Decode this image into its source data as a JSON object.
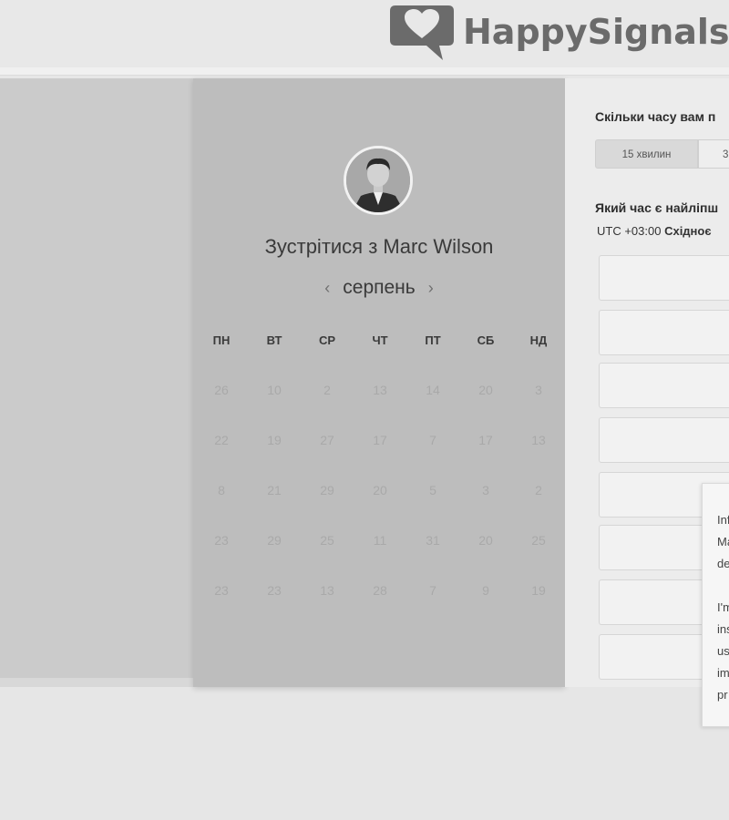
{
  "brand": {
    "name": "HappySignals"
  },
  "calendar": {
    "meet_title": "Зустрітися з Marc Wilson",
    "month": "серпень",
    "prev_icon": "‹",
    "next_icon": "›",
    "weekdays": [
      "ПН",
      "ВТ",
      "СР",
      "ЧТ",
      "ПТ",
      "СБ",
      "НД"
    ],
    "weeks": [
      [
        "26",
        "10",
        "2",
        "13",
        "14",
        "20",
        "3"
      ],
      [
        "22",
        "19",
        "27",
        "17",
        "7",
        "17",
        "13"
      ],
      [
        "8",
        "21",
        "29",
        "20",
        "5",
        "3",
        "2"
      ],
      [
        "23",
        "29",
        "25",
        "11",
        "31",
        "20",
        "25"
      ],
      [
        "23",
        "23",
        "13",
        "28",
        "7",
        "9",
        "19"
      ]
    ]
  },
  "booking": {
    "duration_question": "Скільки часу вам п",
    "durations": [
      "15 хвилин",
      "3"
    ],
    "time_question": "Який час є найліпш",
    "timezone_offset": "UTC +03:00",
    "timezone_name": "Східноє"
  },
  "popup": {
    "lines": [
      "Inf",
      "Ma",
      "de",
      "",
      "I'm",
      "ins",
      "us",
      "im",
      "pr"
    ]
  },
  "colors": {
    "accent": "#6b6b6b",
    "calendar_bg": "#bdbdbd"
  }
}
